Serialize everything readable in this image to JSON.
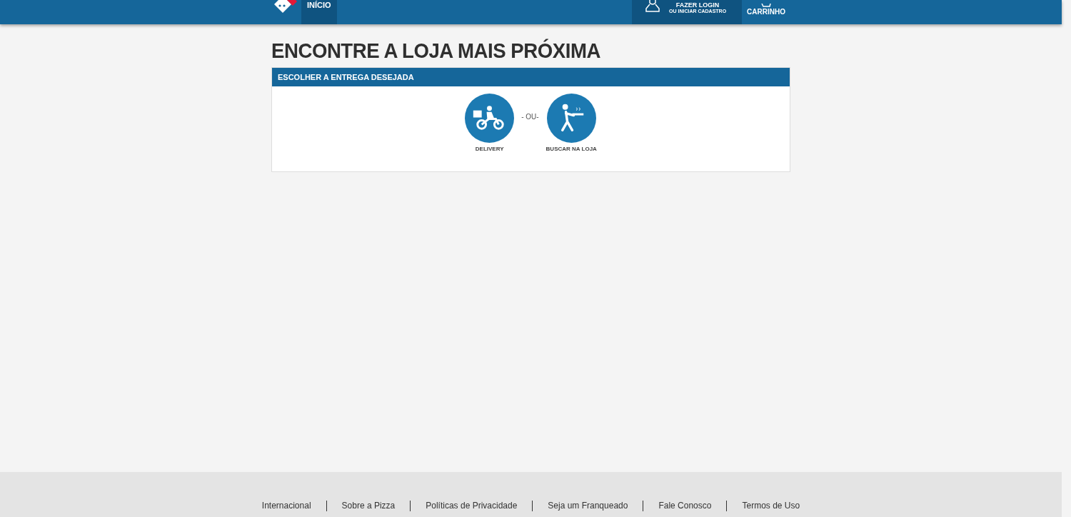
{
  "header": {
    "nav": [
      {
        "label": "INÍCIO",
        "selected": true
      }
    ],
    "login": {
      "title": "FAZER LOGIN",
      "subtitle": "OU INICIAR CADASTRO"
    },
    "cart": {
      "label": "CARRINHO"
    }
  },
  "title": "ENCONTRE A LOJA MAIS PRÓXIMA",
  "panel": {
    "heading": "ESCOLHER A ENTREGA DESEJADA",
    "separator": "- OU-",
    "options": [
      {
        "kind": "delivery",
        "label": "DELIVERY"
      },
      {
        "kind": "pickup",
        "label": "BUSCAR NA LOJA"
      }
    ]
  },
  "footer": {
    "links": [
      "Internacional",
      "Sobre a Pizza",
      "Políticas de Privacidade",
      "Seja um Franqueado",
      "Fale Conosco",
      "Termos de Uso"
    ]
  }
}
